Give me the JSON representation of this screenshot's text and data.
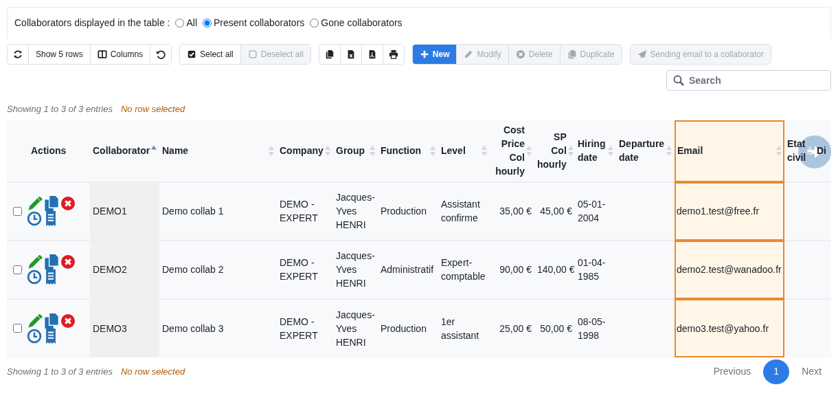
{
  "filter": {
    "label": "Collaborators displayed in the table :",
    "options": [
      {
        "label": "All",
        "selected": false
      },
      {
        "label": "Present collaborators",
        "selected": true
      },
      {
        "label": "Gone collaborators",
        "selected": false
      }
    ]
  },
  "toolbar": [
    {
      "buttons": [
        {
          "kind": "refresh",
          "disabled": false
        },
        {
          "label": "Show 5 rows",
          "disabled": false
        },
        {
          "kind": "columns",
          "label": "Columns",
          "disabled": false
        },
        {
          "kind": "undo",
          "disabled": false
        }
      ]
    },
    {
      "buttons": [
        {
          "kind": "checked",
          "label": "Select all",
          "disabled": false
        },
        {
          "kind": "unchecked",
          "label": "Deselect all",
          "disabled": true
        }
      ]
    },
    {
      "buttons": [
        {
          "kind": "copy",
          "disabled": false
        },
        {
          "kind": "excel",
          "disabled": false
        },
        {
          "kind": "pdf",
          "disabled": false
        },
        {
          "kind": "print",
          "disabled": false
        }
      ]
    },
    {
      "buttons": [
        {
          "kind": "plus",
          "label": "New",
          "disabled": false,
          "primary": true
        },
        {
          "kind": "pencil",
          "label": "Modify",
          "disabled": true
        },
        {
          "kind": "delete",
          "label": "Delete",
          "disabled": true
        },
        {
          "kind": "copy",
          "label": "Duplicate",
          "disabled": true
        }
      ]
    },
    {
      "buttons": [
        {
          "kind": "send",
          "label": "Sending email to a collaborator",
          "disabled": true
        }
      ]
    }
  ],
  "search": {
    "placeholder": "Search"
  },
  "info_top": {
    "entries": "Showing 1 to 3 of 3 entries",
    "selection": "No row selected"
  },
  "table": {
    "columns": [
      {
        "label": "Actions"
      },
      {
        "label": "Collaborator",
        "sortable": true,
        "sorted": true
      },
      {
        "label": "Name",
        "sortable": true
      },
      {
        "label": "Company",
        "sortable": true
      },
      {
        "label": "Group",
        "sortable": true
      },
      {
        "label": "Function",
        "sortable": true
      },
      {
        "label": "Level",
        "sortable": true
      },
      {
        "label": "Cost Price Col hourly",
        "sortable": true,
        "numeric": true
      },
      {
        "label": "SP Col hourly",
        "sortable": true,
        "numeric": true
      },
      {
        "label": "Hiring date",
        "sortable": true
      },
      {
        "label": "Departure date",
        "sortable": true
      },
      {
        "label": "Email",
        "sortable": true,
        "highlighted": true
      },
      {
        "label": "Etat civil",
        "sortable": true
      },
      {
        "label": "Di"
      }
    ],
    "rows": [
      {
        "checked": false,
        "cells": [
          "",
          "DEMO1",
          "Demo collab 1",
          "DEMO - EXPERT",
          "Jacques-Yves HENRI",
          "Production",
          "Assistant confirme",
          "35,00 €",
          "45,00 €",
          "05-01-2004",
          "",
          "demo1.test@free.fr",
          "",
          ""
        ]
      },
      {
        "checked": false,
        "cells": [
          "",
          "DEMO2",
          "Demo collab 2",
          "DEMO - EXPERT",
          "Jacques-Yves HENRI",
          "Administratif",
          "Expert-comptable",
          "90,00 €",
          "140,00 €",
          "01-04-1985",
          "",
          "demo2.test@wanadoo.fr",
          "",
          ""
        ]
      },
      {
        "checked": false,
        "cells": [
          "",
          "DEMO3",
          "Demo collab 3",
          "DEMO - EXPERT",
          "Jacques-Yves HENRI",
          "Production",
          "1er assistant",
          "25,00 €",
          "50,00 €",
          "08-05-1998",
          "",
          "demo3.test@yahoo.fr",
          "",
          ""
        ]
      }
    ]
  },
  "info_bottom": {
    "entries": "Showing 1 to 3 of 3 entries",
    "selection": "No row selected"
  },
  "pagination": [
    {
      "label": "Previous",
      "selected": false
    },
    {
      "label": "1",
      "selected": true
    },
    {
      "label": "Next",
      "selected": false
    }
  ]
}
